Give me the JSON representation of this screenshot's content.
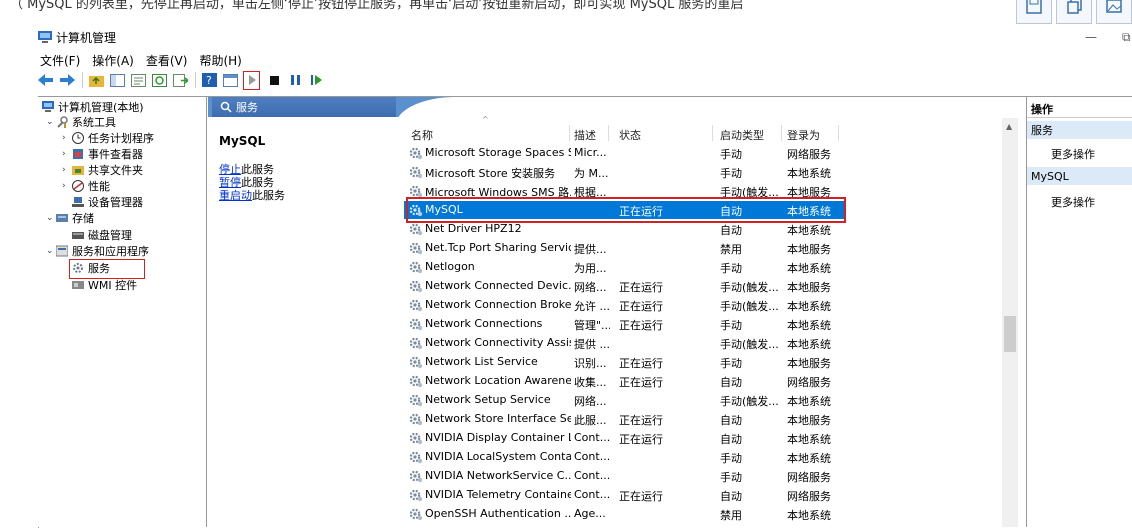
{
  "background_text": "（ MySQL 的列表里，先停止再启动，单击左侧‘停止’按钮停止服务，再单击‘启动’按钮重新启动，即可实现 MySQL 服务的重启",
  "window": {
    "title": "计算机管理",
    "minimize": "—",
    "restore": "⧉"
  },
  "menu": [
    "文件(F)",
    "操作(A)",
    "查看(V)",
    "帮助(H)"
  ],
  "tree": {
    "root": "计算机管理(本地)",
    "items": [
      {
        "label": "系统工具",
        "twisty": "⌄",
        "icon": "tools-icon"
      },
      {
        "label": "任务计划程序",
        "twisty": "›",
        "icon": "clock-icon"
      },
      {
        "label": "事件查看器",
        "twisty": "›",
        "icon": "event-viewer-icon"
      },
      {
        "label": "共享文件夹",
        "twisty": "›",
        "icon": "shared-folder-icon"
      },
      {
        "label": "性能",
        "twisty": "›",
        "icon": "performance-icon"
      },
      {
        "label": "设备管理器",
        "twisty": "",
        "icon": "device-manager-icon"
      },
      {
        "label": "存储",
        "twisty": "⌄",
        "icon": "storage-icon"
      },
      {
        "label": "磁盘管理",
        "twisty": "",
        "icon": "disk-icon"
      },
      {
        "label": "服务和应用程序",
        "twisty": "⌄",
        "icon": "services-apps-icon"
      },
      {
        "label": "服务",
        "twisty": "",
        "icon": "services-icon"
      },
      {
        "label": "WMI 控件",
        "twisty": "",
        "icon": "wmi-icon"
      }
    ]
  },
  "pane": {
    "tab_label": "服务",
    "selected_service": "MySQL",
    "links": [
      {
        "link": "停止",
        "rest": "此服务"
      },
      {
        "link": "暂停",
        "rest": "此服务"
      },
      {
        "link": "重启动",
        "rest": "此服务"
      }
    ]
  },
  "columns": {
    "name": "名称",
    "desc": "描述",
    "status": "状态",
    "startup": "启动类型",
    "logon": "登录为"
  },
  "rows": [
    {
      "name": "Microsoft Storage Spaces S...",
      "desc": "Micr...",
      "status": "",
      "startup": "手动",
      "logon": "网络服务"
    },
    {
      "name": "Microsoft Store 安装服务",
      "desc": "为 M...",
      "status": "",
      "startup": "手动",
      "logon": "本地系统"
    },
    {
      "name": "Microsoft Windows SMS 路...",
      "desc": "根据...",
      "status": "",
      "startup": "手动(触发...",
      "logon": "本地服务"
    },
    {
      "name": "MySQL",
      "desc": "",
      "status": "正在运行",
      "startup": "自动",
      "logon": "本地系统",
      "selected": true
    },
    {
      "name": "Net Driver HPZ12",
      "desc": "",
      "status": "",
      "startup": "自动",
      "logon": "本地系统"
    },
    {
      "name": "Net.Tcp Port Sharing Service",
      "desc": "提供...",
      "status": "",
      "startup": "禁用",
      "logon": "本地服务"
    },
    {
      "name": "Netlogon",
      "desc": "为用...",
      "status": "",
      "startup": "手动",
      "logon": "本地系统"
    },
    {
      "name": "Network Connected Devic...",
      "desc": "网络...",
      "status": "正在运行",
      "startup": "手动(触发...",
      "logon": "本地服务"
    },
    {
      "name": "Network Connection Broker",
      "desc": "允许 ...",
      "status": "正在运行",
      "startup": "手动(触发...",
      "logon": "本地系统"
    },
    {
      "name": "Network Connections",
      "desc": "管理\"...",
      "status": "正在运行",
      "startup": "手动",
      "logon": "本地系统"
    },
    {
      "name": "Network Connectivity Assis...",
      "desc": "提供 ...",
      "status": "",
      "startup": "手动(触发...",
      "logon": "本地系统"
    },
    {
      "name": "Network List Service",
      "desc": "识别...",
      "status": "正在运行",
      "startup": "手动",
      "logon": "本地服务"
    },
    {
      "name": "Network Location Awarene...",
      "desc": "收集...",
      "status": "正在运行",
      "startup": "自动",
      "logon": "网络服务"
    },
    {
      "name": "Network Setup Service",
      "desc": "网络...",
      "status": "",
      "startup": "手动(触发...",
      "logon": "本地系统"
    },
    {
      "name": "Network Store Interface Se...",
      "desc": "此服...",
      "status": "正在运行",
      "startup": "自动",
      "logon": "本地服务"
    },
    {
      "name": "NVIDIA Display Container LS",
      "desc": "Cont...",
      "status": "正在运行",
      "startup": "自动",
      "logon": "本地系统"
    },
    {
      "name": "NVIDIA LocalSystem Conta...",
      "desc": "Cont...",
      "status": "",
      "startup": "手动",
      "logon": "本地系统"
    },
    {
      "name": "NVIDIA NetworkService C...",
      "desc": "Cont...",
      "status": "",
      "startup": "手动",
      "logon": "网络服务"
    },
    {
      "name": "NVIDIA Telemetry Container",
      "desc": "Cont...",
      "status": "正在运行",
      "startup": "自动",
      "logon": "网络服务"
    },
    {
      "name": "OpenSSH Authentication ...",
      "desc": "Age...",
      "status": "",
      "startup": "禁用",
      "logon": "本地系统"
    }
  ],
  "actions": {
    "header": "操作",
    "group1": "服务",
    "group1_item": "更多操作",
    "group2": "MySQL",
    "group2_item": "更多操作"
  },
  "colors": {
    "accent": "#0078d7",
    "highlight_border": "#d32020",
    "pane_header": "#5b90cf"
  }
}
